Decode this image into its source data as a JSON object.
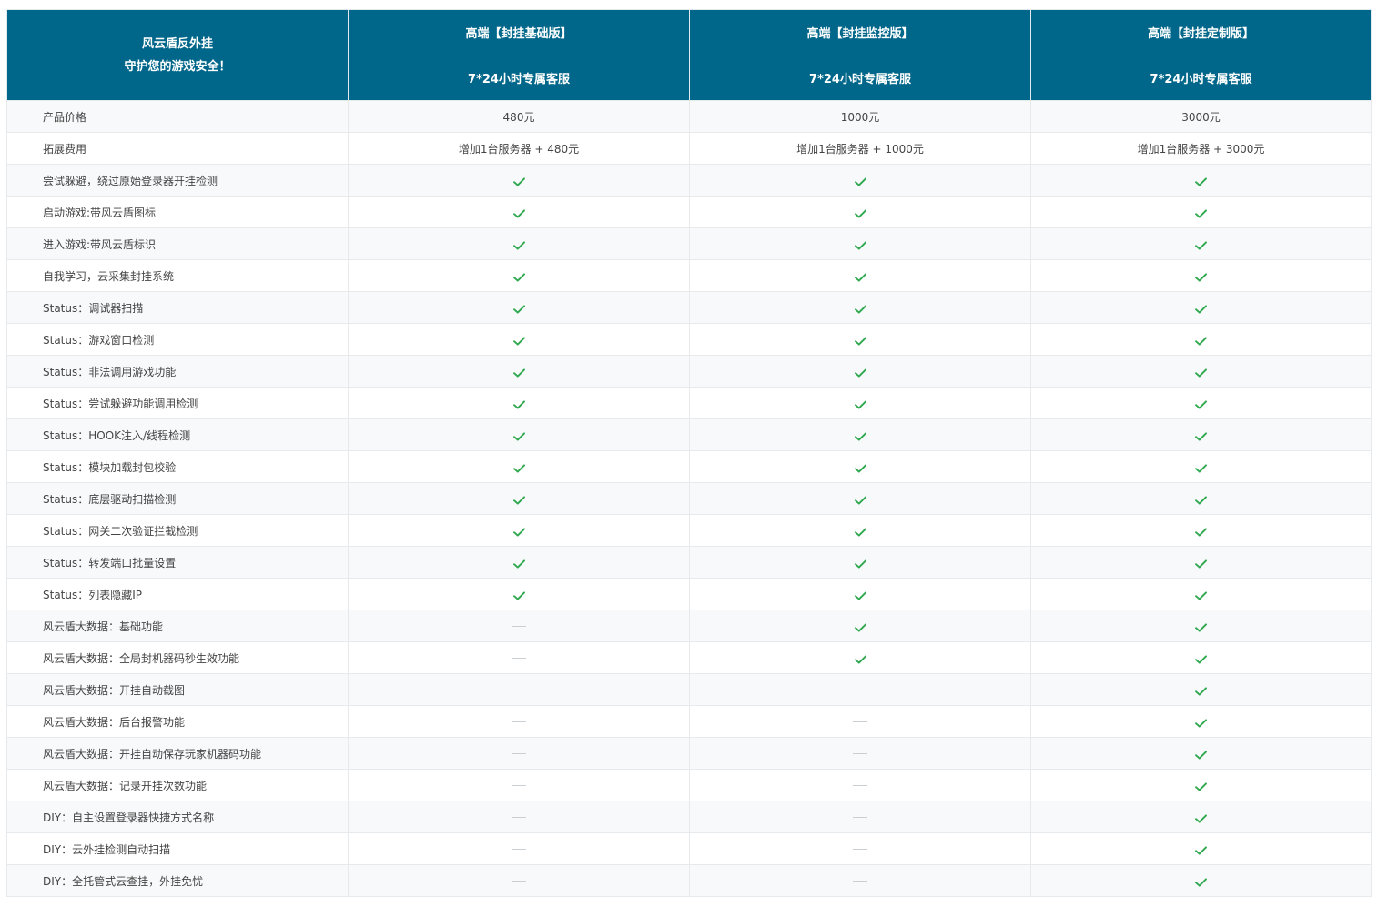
{
  "header": {
    "brand_line1": "风云盾反外挂",
    "brand_line2": "守护您的游戏安全！",
    "plans": [
      {
        "name": "高端【封挂基础版】",
        "service": "7*24小时专属客服"
      },
      {
        "name": "高端【封挂监控版】",
        "service": "7*24小时专属客服"
      },
      {
        "name": "高端【封挂定制版】",
        "service": "7*24小时专属客服"
      }
    ]
  },
  "text_rows": [
    {
      "label": "产品价格",
      "values": [
        "480元",
        "1000元",
        "3000元"
      ]
    },
    {
      "label": "拓展费用",
      "values": [
        "增加1台服务器 + 480元",
        "增加1台服务器 + 1000元",
        "增加1台服务器 + 3000元"
      ]
    }
  ],
  "feature_rows": [
    {
      "label": "尝试躲避，绕过原始登录器开挂检测",
      "support": [
        true,
        true,
        true
      ]
    },
    {
      "label": "启动游戏:带风云盾图标",
      "support": [
        true,
        true,
        true
      ]
    },
    {
      "label": "进入游戏:带风云盾标识",
      "support": [
        true,
        true,
        true
      ]
    },
    {
      "label": "自我学习，云采集封挂系统",
      "support": [
        true,
        true,
        true
      ]
    },
    {
      "label": "Status：调试器扫描",
      "support": [
        true,
        true,
        true
      ]
    },
    {
      "label": "Status：游戏窗口检测",
      "support": [
        true,
        true,
        true
      ]
    },
    {
      "label": "Status：非法调用游戏功能",
      "support": [
        true,
        true,
        true
      ]
    },
    {
      "label": "Status：尝试躲避功能调用检测",
      "support": [
        true,
        true,
        true
      ]
    },
    {
      "label": "Status：HOOK注入/线程检测",
      "support": [
        true,
        true,
        true
      ]
    },
    {
      "label": "Status：模块加载封包校验",
      "support": [
        true,
        true,
        true
      ]
    },
    {
      "label": "Status：底层驱动扫描检测",
      "support": [
        true,
        true,
        true
      ]
    },
    {
      "label": "Status：网关二次验证拦截检测",
      "support": [
        true,
        true,
        true
      ]
    },
    {
      "label": "Status：转发端口批量设置",
      "support": [
        true,
        true,
        true
      ]
    },
    {
      "label": "Status：列表隐藏IP",
      "support": [
        true,
        true,
        true
      ]
    },
    {
      "label": "风云盾大数据：基础功能",
      "support": [
        false,
        true,
        true
      ]
    },
    {
      "label": "风云盾大数据：全局封机器码秒生效功能",
      "support": [
        false,
        true,
        true
      ]
    },
    {
      "label": "风云盾大数据：开挂自动截图",
      "support": [
        false,
        false,
        true
      ]
    },
    {
      "label": "风云盾大数据：后台报警功能",
      "support": [
        false,
        false,
        true
      ]
    },
    {
      "label": "风云盾大数据：开挂自动保存玩家机器码功能",
      "support": [
        false,
        false,
        true
      ]
    },
    {
      "label": "风云盾大数据：记录开挂次数功能",
      "support": [
        false,
        false,
        true
      ]
    },
    {
      "label": "DIY：自主设置登录器快捷方式名称",
      "support": [
        false,
        false,
        true
      ]
    },
    {
      "label": "DIY：云外挂检测自动扫描",
      "support": [
        false,
        false,
        true
      ]
    },
    {
      "label": "DIY：全托管式云查挂，外挂免忧",
      "support": [
        false,
        false,
        true
      ]
    }
  ],
  "icons": {
    "supported": "check-icon",
    "unsupported": "dash-icon"
  },
  "colors": {
    "header_bg": "#00678a",
    "check": "#2fa84f",
    "dash": "#c9cfd3",
    "stripe": "#f7f9fa"
  }
}
